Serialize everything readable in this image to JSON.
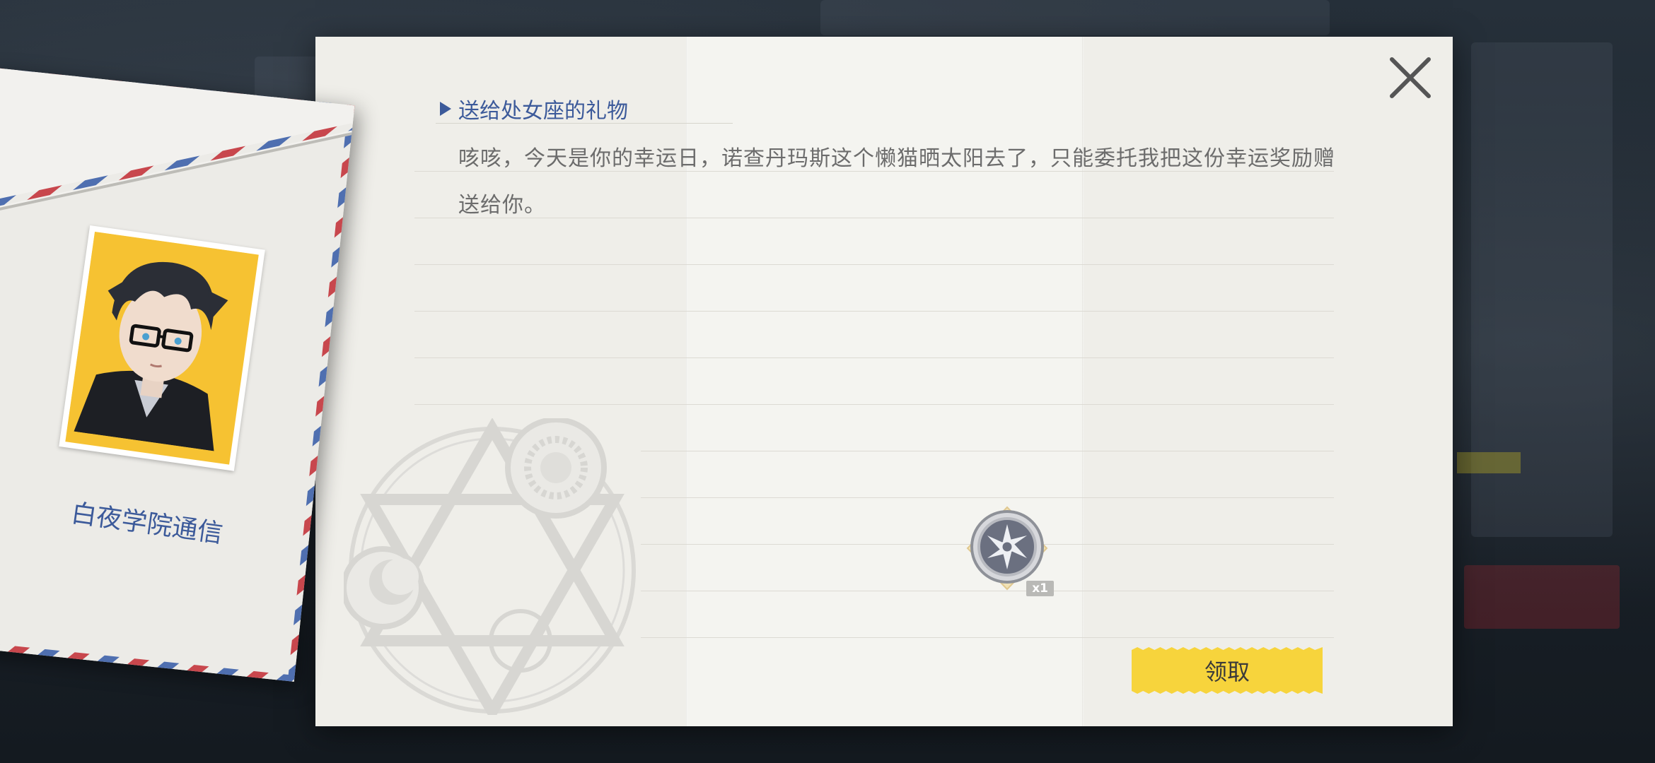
{
  "letter": {
    "title": "送给处女座的礼物",
    "body": "咳咳，今天是你的幸运日，诺查丹玛斯这个懒猫晒太阳去了，只能委托我把这份幸运奖励赠送给你。",
    "reward": {
      "icon": "silver-gear-badge-icon",
      "quantity": "x1"
    },
    "claim_label": "领取"
  },
  "envelope": {
    "label": "白夜学院通信",
    "portrait": "glasses-boy-avatar"
  },
  "colors": {
    "title_blue": "#3c5a9a",
    "claim_yellow": "#f7d43c",
    "paper": "#efeee9",
    "airmail_red": "#c8474d",
    "airmail_blue": "#4f6fb0"
  }
}
